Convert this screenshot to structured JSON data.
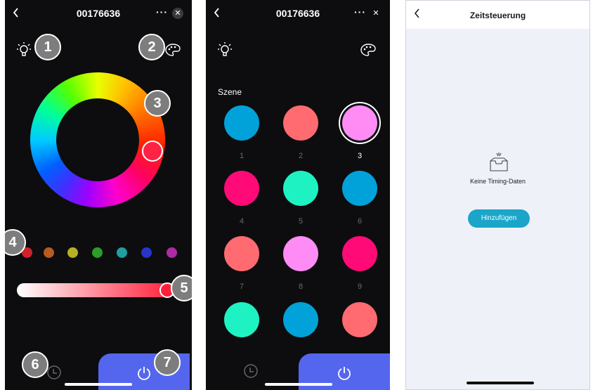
{
  "screens": [
    {
      "title": "00176636",
      "more_label": "···",
      "close_label": "✕",
      "callouts": [
        "1",
        "2",
        "3",
        "4",
        "5",
        "6",
        "7"
      ],
      "icons": {
        "left": "bulb-icon",
        "right": "palette-icon"
      },
      "preset_colors": [
        "#d0222a",
        "#b75b1e",
        "#b6b024",
        "#2a9d2a",
        "#1f9f9f",
        "#2636c8",
        "#b02aa8"
      ],
      "selected_color": "#ff2244",
      "brightness_value": 0.97
    },
    {
      "title": "00176636",
      "more_label": "···",
      "close_label": "✕",
      "scene_label": "Szene",
      "scenes": [
        {
          "number": "1",
          "color": "#00a2d9"
        },
        {
          "number": "2",
          "color": "#ff6b70"
        },
        {
          "number": "3",
          "color": "#ff8cf5",
          "selected": true
        },
        {
          "number": "4",
          "color": "#ff0a77"
        },
        {
          "number": "5",
          "color": "#1ef2c3"
        },
        {
          "number": "6",
          "color": "#00a2d9"
        },
        {
          "number": "7",
          "color": "#ff6b70"
        },
        {
          "number": "8",
          "color": "#ff8cf5"
        },
        {
          "number": "9",
          "color": "#ff0a77"
        },
        {
          "number": "",
          "color": "#1ef2c3"
        },
        {
          "number": "",
          "color": "#00a2d9"
        },
        {
          "number": "",
          "color": "#ff6b70"
        }
      ]
    },
    {
      "title": "Zeitsteuerung",
      "empty_text": "Keine Timing-Daten",
      "add_button": "Hinzufügen"
    }
  ],
  "colors": {
    "accent": "#5566ee",
    "add_button": "#1aa5c9"
  }
}
